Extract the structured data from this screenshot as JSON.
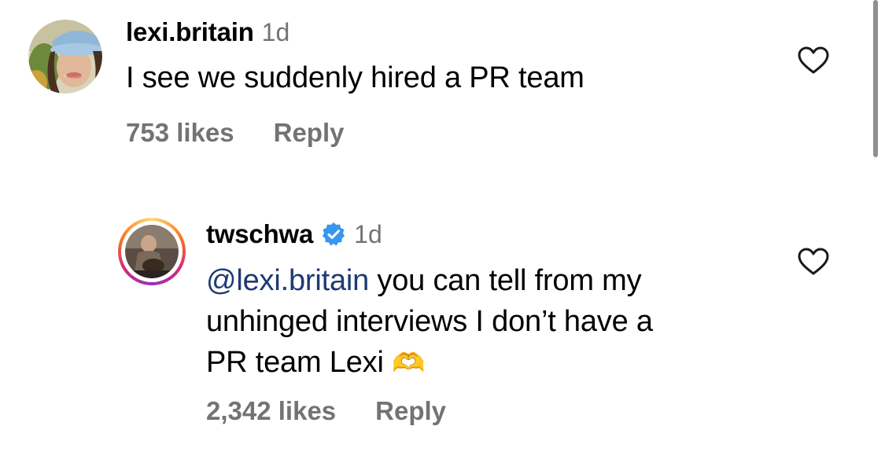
{
  "comments": [
    {
      "username": "lexi.britain",
      "time": "1d",
      "text": "I see we suddenly hired a PR team",
      "likes": "753 likes",
      "reply": "Reply"
    },
    {
      "username": "twschwa",
      "time": "1d",
      "mention": "@lexi.britain",
      "text_line1": " you can tell from my",
      "text_line2": "unhinged interviews I don’t have a",
      "text_line3": "PR team Lexi ",
      "emoji": "🫶",
      "likes": "2,342 likes",
      "reply": "Reply"
    }
  ],
  "icons": {
    "heart": "heart-icon",
    "verified": "verified-badge-icon",
    "scrollbar_color": "#8f8f8f",
    "verified_color": "#3797f0",
    "story_ring_colors": [
      "#feda75",
      "#fa7e1e",
      "#d62976",
      "#962fbf"
    ]
  }
}
